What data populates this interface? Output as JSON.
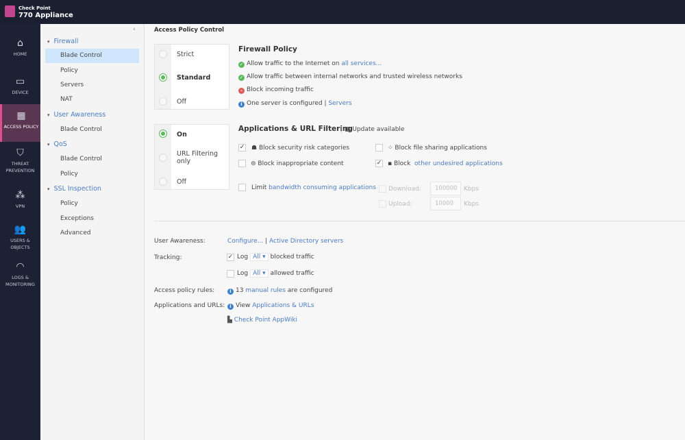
{
  "header": {
    "brand_small": "Check Point",
    "brand_large": "770 Appliance",
    "accent": "#c2458f"
  },
  "rail": [
    {
      "label": "HOME",
      "icon": "home-icon"
    },
    {
      "label": "DEVICE",
      "icon": "device-icon"
    },
    {
      "label": "ACCESS POLICY",
      "icon": "firewall-icon",
      "active": true
    },
    {
      "label": "THREAT PREVENTION",
      "icon": "shield-icon"
    },
    {
      "label": "VPN",
      "icon": "vpn-icon"
    },
    {
      "label": "USERS & OBJECTS",
      "icon": "users-icon"
    },
    {
      "label": "LOGS & MONITORING",
      "icon": "gauge-icon"
    }
  ],
  "subnav": {
    "groups": [
      {
        "label": "Firewall",
        "items": [
          "Blade Control",
          "Policy",
          "Servers",
          "NAT"
        ]
      },
      {
        "label": "User Awareness",
        "items": [
          "Blade Control"
        ]
      },
      {
        "label": "QoS",
        "items": [
          "Blade Control",
          "Policy"
        ]
      },
      {
        "label": "SSL Inspection",
        "items": [
          "Policy",
          "Exceptions",
          "Advanced"
        ]
      }
    ],
    "selected": "Firewall / Blade Control"
  },
  "main": {
    "title": "Access Policy Control",
    "firewall": {
      "options": [
        "Strict",
        "Standard",
        "Off"
      ],
      "selected": "Standard",
      "heading": "Firewall Policy",
      "l1": "Allow traffic to the Internet on ",
      "l1_link": "all services...",
      "l2": "Allow traffic between internal networks and trusted wireless networks",
      "l3": "Block incoming traffic",
      "l4": "One server is configured | ",
      "l4_link": "Servers"
    },
    "apps": {
      "options": [
        "On",
        "URL Filtering only",
        "Off"
      ],
      "selected": "On",
      "heading": "Applications & URL Filtering",
      "update": "Update available",
      "security_risk": {
        "label": "Block security risk categories",
        "checked": true
      },
      "file_sharing": {
        "label": "Block file sharing applications",
        "checked": false
      },
      "inappropriate": {
        "label": "Block inappropriate content",
        "checked": false
      },
      "other": {
        "label": "Block",
        "link": "other undesired applications",
        "checked": true
      },
      "limit": {
        "label": "Limit ",
        "link": "bandwidth consuming applications",
        "checked": false
      },
      "download": {
        "label": "Download:",
        "value": "100000",
        "unit": "Kbps"
      },
      "upload": {
        "label": "Upload:",
        "value": "10000",
        "unit": "Kbps"
      }
    },
    "user_awareness": {
      "label": "User Awareness:",
      "configure": "Configure...",
      "sep": "|",
      "ad": "Active Directory servers"
    },
    "tracking": {
      "label": "Tracking:",
      "row1": {
        "log": "Log",
        "select": "All ▾",
        "text": "blocked traffic",
        "checked": true
      },
      "row2": {
        "log": "Log",
        "select": "All ▾",
        "text": "allowed traffic",
        "checked": false
      }
    },
    "rules": {
      "label": "Access policy rules:",
      "count": "13 ",
      "link": "manual rules",
      "text": " are configured"
    },
    "apps_urls": {
      "label": "Applications and URLs:",
      "view": "View ",
      "link": "Applications & URLs",
      "appwiki": "Check Point AppWiki"
    }
  }
}
